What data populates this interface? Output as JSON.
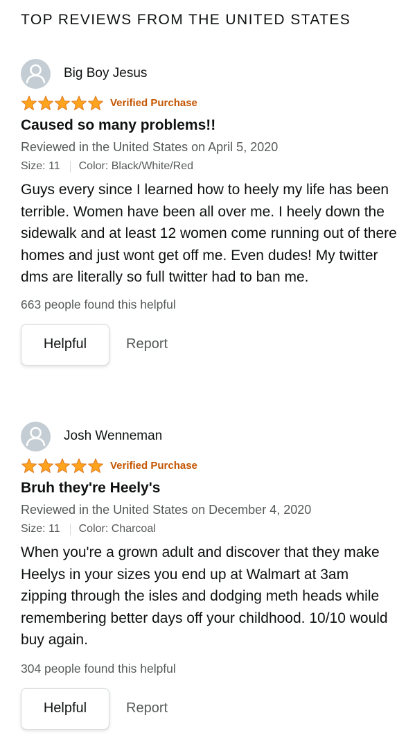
{
  "section": {
    "heading": "TOP REVIEWS FROM THE UNITED STATES"
  },
  "colors": {
    "star": "#ffa41c",
    "verified": "#c45500",
    "secondary_text": "#565959",
    "avatar_bg": "#c3cdd3"
  },
  "reviews": [
    {
      "avatar_icon": "default-user-avatar-icon",
      "profile_name": "Big Boy Jesus",
      "rating": 5,
      "rating_max": 5,
      "verified": "Verified Purchase",
      "title": "Caused so many problems!!",
      "date_line": "Reviewed in the United States on April 5, 2020",
      "size": "Size: 11",
      "color": "Color: Black/White/Red",
      "body": "Guys every since I learned how to heely my life has been terrible. Women have been all over me. I heely down the sidewalk and at least 12 women come running out of there homes and just wont get off me. Even dudes! My twitter dms are literally so full twitter had to ban me.",
      "helpful_count": "663 people found this helpful",
      "helpful_label": "Helpful",
      "report_label": "Report"
    },
    {
      "avatar_icon": "default-user-avatar-icon",
      "profile_name": "Josh Wenneman",
      "rating": 5,
      "rating_max": 5,
      "verified": "Verified Purchase",
      "title": "Bruh they're Heely's",
      "date_line": "Reviewed in the United States on December 4, 2020",
      "size": "Size: 11",
      "color": "Color: Charcoal",
      "body": "When you're a grown adult and discover that they make Heelys in your sizes you end up at Walmart at 3am zipping through the isles and dodging meth heads while remembering better days off your childhood. 10/10 would buy again.",
      "helpful_count": "304 people found this helpful",
      "helpful_label": "Helpful",
      "report_label": "Report"
    }
  ]
}
